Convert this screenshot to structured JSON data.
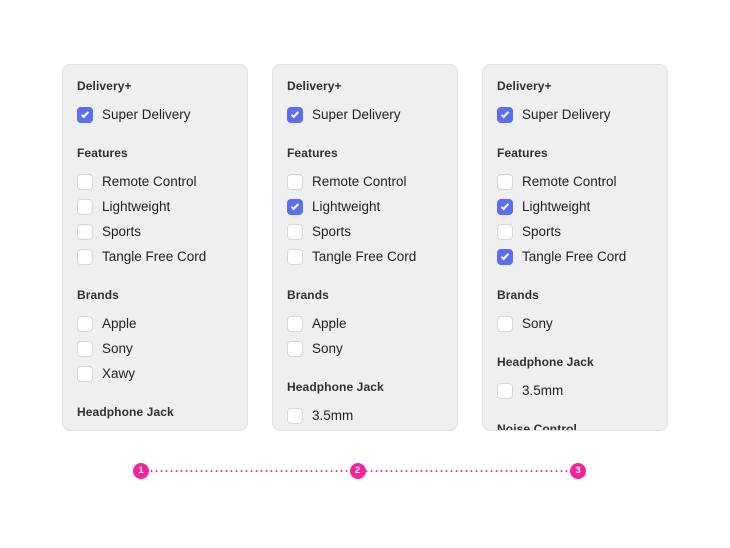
{
  "theme": {
    "accent_checkbox": "#5b6cf5",
    "accent_stepper": "#f5239b",
    "panel_background": "#efefef",
    "page_background": "#ffffff"
  },
  "panels": [
    {
      "name": "filter-panel-step-1",
      "groups": [
        {
          "title": "Delivery+",
          "options": [
            {
              "label": "Super Delivery",
              "checked": true
            }
          ]
        },
        {
          "title": "Features",
          "options": [
            {
              "label": "Remote Control",
              "checked": false
            },
            {
              "label": "Lightweight",
              "checked": false
            },
            {
              "label": "Sports",
              "checked": false
            },
            {
              "label": "Tangle Free Cord",
              "checked": false
            }
          ]
        },
        {
          "title": "Brands",
          "options": [
            {
              "label": "Apple",
              "checked": false
            },
            {
              "label": "Sony",
              "checked": false
            },
            {
              "label": "Xawy",
              "checked": false
            }
          ]
        },
        {
          "title": "Headphone Jack",
          "options": []
        }
      ]
    },
    {
      "name": "filter-panel-step-2",
      "groups": [
        {
          "title": "Delivery+",
          "options": [
            {
              "label": "Super Delivery",
              "checked": true
            }
          ]
        },
        {
          "title": "Features",
          "options": [
            {
              "label": "Remote Control",
              "checked": false
            },
            {
              "label": "Lightweight",
              "checked": true
            },
            {
              "label": "Sports",
              "checked": false
            },
            {
              "label": "Tangle Free Cord",
              "checked": false
            }
          ]
        },
        {
          "title": "Brands",
          "options": [
            {
              "label": "Apple",
              "checked": false
            },
            {
              "label": "Sony",
              "checked": false
            }
          ]
        },
        {
          "title": "Headphone Jack",
          "options": [
            {
              "label": "3.5mm",
              "checked": false
            }
          ]
        }
      ]
    },
    {
      "name": "filter-panel-step-3",
      "groups": [
        {
          "title": "Delivery+",
          "options": [
            {
              "label": "Super Delivery",
              "checked": true
            }
          ]
        },
        {
          "title": "Features",
          "options": [
            {
              "label": "Remote Control",
              "checked": false
            },
            {
              "label": "Lightweight",
              "checked": true
            },
            {
              "label": "Sports",
              "checked": false
            },
            {
              "label": "Tangle Free Cord",
              "checked": true
            }
          ]
        },
        {
          "title": "Brands",
          "options": [
            {
              "label": "Sony",
              "checked": false
            }
          ]
        },
        {
          "title": "Headphone Jack",
          "options": [
            {
              "label": "3.5mm",
              "checked": false
            }
          ]
        },
        {
          "title": "Noise Control",
          "options": []
        }
      ]
    }
  ],
  "stepper": {
    "steps": [
      {
        "label": "1"
      },
      {
        "label": "2"
      },
      {
        "label": "3"
      }
    ]
  }
}
